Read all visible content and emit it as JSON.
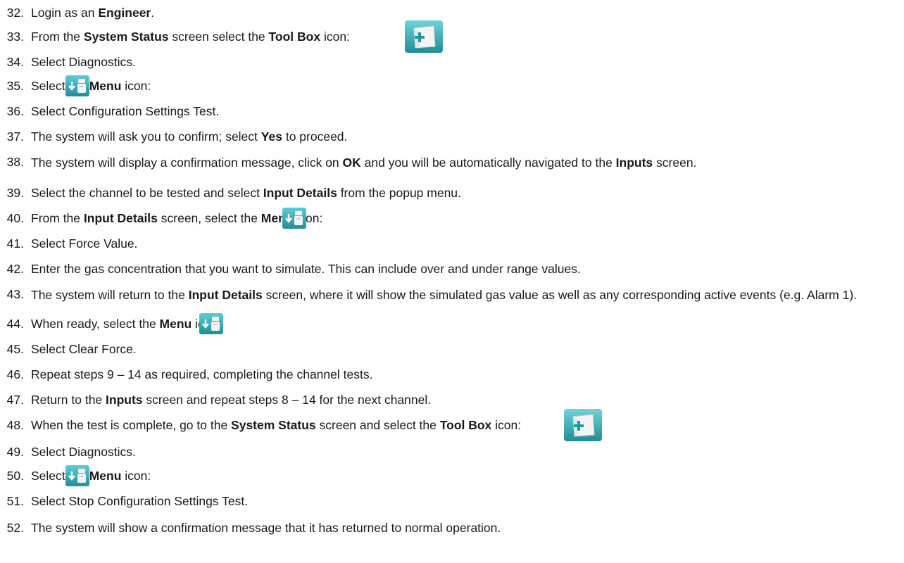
{
  "items": [
    {
      "num": "32.",
      "parts": [
        {
          "t": "Login as an "
        },
        {
          "t": "Engineer",
          "b": true
        },
        {
          "t": "."
        }
      ]
    },
    {
      "num": "33.",
      "parts": [
        {
          "t": "From the "
        },
        {
          "t": "System Status",
          "b": true
        },
        {
          "t": " screen select the "
        },
        {
          "t": "Tool Box",
          "b": true
        },
        {
          "t": " icon:"
        }
      ],
      "icon": "toolbox-icon"
    },
    {
      "num": "34.",
      "parts": [
        {
          "t": "Select Diagnostics."
        }
      ]
    },
    {
      "num": "35.",
      "parts": [
        {
          "t": "Select the "
        },
        {
          "t": "Menu",
          "b": true
        },
        {
          "t": " icon:"
        }
      ],
      "icon": "menu-icon"
    },
    {
      "num": "36.",
      "parts": [
        {
          "t": "Select Configuration Settings Test."
        }
      ]
    },
    {
      "num": "37.",
      "parts": [
        {
          "t": "The system will ask you to confirm; select "
        },
        {
          "t": "Yes",
          "b": true
        },
        {
          "t": " to proceed."
        }
      ]
    },
    {
      "num": "38.",
      "parts": [
        {
          "t": "The system will display a confirmation message, click on "
        },
        {
          "t": "OK",
          "b": true
        },
        {
          "t": " and you will be automatically navigated to the "
        },
        {
          "t": "Inputs",
          "b": true
        },
        {
          "t": " screen."
        }
      ]
    },
    {
      "num": "39.",
      "parts": [
        {
          "t": "Select the channel to be tested and select "
        },
        {
          "t": "Input Details",
          "b": true
        },
        {
          "t": " from the popup menu."
        }
      ]
    },
    {
      "num": "40.",
      "parts": [
        {
          "t": "From the "
        },
        {
          "t": "Input Details",
          "b": true
        },
        {
          "t": " screen, select the "
        },
        {
          "t": "Menu",
          "b": true
        },
        {
          "t": " icon:"
        }
      ],
      "icon": "menu-icon"
    },
    {
      "num": "41.",
      "parts": [
        {
          "t": "Select Force Value."
        }
      ]
    },
    {
      "num": "42.",
      "parts": [
        {
          "t": "Enter the gas concentration that you want to simulate. This can include over and under range values."
        }
      ]
    },
    {
      "num": "43.",
      "parts": [
        {
          "t": "The system will return to the "
        },
        {
          "t": "Input Details",
          "b": true
        },
        {
          "t": " screen, where it will show the simulated gas value as well as any corresponding active events (e.g. Alarm 1)."
        }
      ]
    },
    {
      "num": "44.",
      "parts": [
        {
          "t": "When ready, select the "
        },
        {
          "t": "Menu",
          "b": true
        },
        {
          "t": " icon:"
        }
      ],
      "icon": "menu-icon"
    },
    {
      "num": "45.",
      "parts": [
        {
          "t": "Select Clear Force."
        }
      ]
    },
    {
      "num": "46.",
      "parts": [
        {
          "t": "Repeat steps 9 – 14 as required, completing the channel tests."
        }
      ]
    },
    {
      "num": "47.",
      "parts": [
        {
          "t": "Return to the "
        },
        {
          "t": "Inputs",
          "b": true
        },
        {
          "t": " screen and repeat steps 8 – 14 for the next channel."
        }
      ]
    },
    {
      "num": "48.",
      "parts": [
        {
          "t": "When the test is complete, go to the "
        },
        {
          "t": "System Status",
          "b": true
        },
        {
          "t": " screen and select the "
        },
        {
          "t": "Tool Box",
          "b": true
        },
        {
          "t": " icon:"
        }
      ],
      "icon": "toolbox-icon"
    },
    {
      "num": "49.",
      "parts": [
        {
          "t": "Select Diagnostics."
        }
      ]
    },
    {
      "num": "50.",
      "parts": [
        {
          "t": "Select the "
        },
        {
          "t": "Menu",
          "b": true
        },
        {
          "t": " icon:"
        }
      ],
      "icon": "menu-icon"
    },
    {
      "num": "51.",
      "parts": [
        {
          "t": "Select Stop Configuration Settings Test."
        }
      ]
    },
    {
      "num": "52.",
      "parts": [
        {
          "t": "The system will show a confirmation message that it has returned to normal operation."
        }
      ]
    }
  ]
}
